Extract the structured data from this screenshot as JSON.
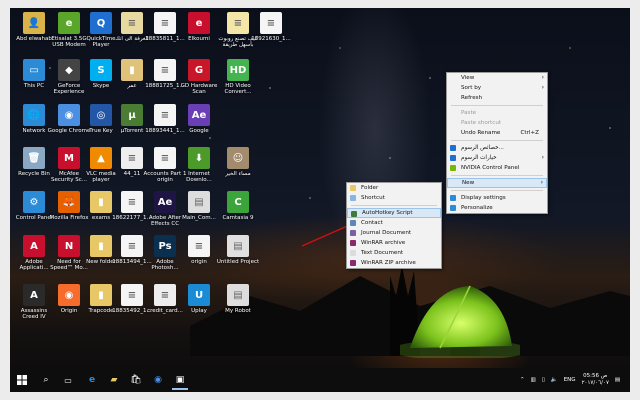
{
  "desktop": {
    "icons": [
      {
        "label": "Abd elwahab",
        "color": "#d9b34a",
        "glyph": "👤"
      },
      {
        "label": "Etisalat 3.5G USB Modem",
        "color": "#5aa62a",
        "glyph": "e"
      },
      {
        "label": "QuickTime Player",
        "color": "#1f6fd1",
        "glyph": "Q"
      },
      {
        "label": "الغرفة الى انك",
        "color": "#e8d9a0",
        "glyph": "≡"
      },
      {
        "label": "18835811_1...",
        "color": "#f5f5f5",
        "glyph": "≡"
      },
      {
        "label": "Elkoumi",
        "color": "#c8102e",
        "glyph": "e"
      },
      {
        "label": "كيف تصنع روبوت بأسهل طريقة",
        "color": "#f3e6a7",
        "glyph": "≡"
      },
      {
        "label": "18921630_1...",
        "color": "#f5f5f5",
        "glyph": "≡"
      },
      {
        "label": "This PC",
        "color": "#2b8bd6",
        "glyph": "▭"
      },
      {
        "label": "GeForce Experience",
        "color": "#444",
        "glyph": "◆"
      },
      {
        "label": "Skype",
        "color": "#00aff0",
        "glyph": "S"
      },
      {
        "label": "عمر",
        "color": "#e0c37a",
        "glyph": "▮"
      },
      {
        "label": "18881725_1...",
        "color": "#f5f5f5",
        "glyph": "≡"
      },
      {
        "label": "GD Hardware Scan",
        "color": "#c9172a",
        "glyph": "G"
      },
      {
        "label": "HD Video Convert...",
        "color": "#45b34f",
        "glyph": "HD"
      },
      {
        "label": "Network",
        "color": "#2b8bd6",
        "glyph": "🌐"
      },
      {
        "label": "Google Chrome",
        "color": "#4a8fe2",
        "glyph": "◉"
      },
      {
        "label": "True Key",
        "color": "#2456a8",
        "glyph": "◎"
      },
      {
        "label": "µTorrent",
        "color": "#4a7d33",
        "glyph": "µ"
      },
      {
        "label": "18893441_1...",
        "color": "#f5f5f5",
        "glyph": "≡"
      },
      {
        "label": "Google",
        "color": "#6a3fb5",
        "glyph": "Ae"
      },
      {
        "label": "Recycle Bin",
        "color": "#8aa7c4",
        "glyph": "🗑"
      },
      {
        "label": "McAfee Security Sc...",
        "color": "#c8102e",
        "glyph": "M"
      },
      {
        "label": "VLC media player",
        "color": "#f08a00",
        "glyph": "▲"
      },
      {
        "label": "44_11",
        "color": "#eee",
        "glyph": "≡"
      },
      {
        "label": "Accounts Part 1 origin",
        "color": "#f5f5f5",
        "glyph": "≡"
      },
      {
        "label": "Internet Downlo...",
        "color": "#4c9a2a",
        "glyph": "⬇"
      },
      {
        "label": "مساء الخير",
        "color": "#a38b6d",
        "glyph": "☺"
      },
      {
        "label": "Control Panel",
        "color": "#2b8bd6",
        "glyph": "⚙"
      },
      {
        "label": "Mozilla Firefox",
        "color": "#e66000",
        "glyph": "🦊"
      },
      {
        "label": "exams",
        "color": "#e8c766",
        "glyph": "▮"
      },
      {
        "label": "18622177_1...",
        "color": "#f5f5f5",
        "glyph": "≡"
      },
      {
        "label": "Adobe After Effects CC",
        "color": "#1e1545",
        "glyph": "Ae"
      },
      {
        "label": "Main_Com...",
        "color": "#ddd",
        "glyph": "▤"
      },
      {
        "label": "Camtasia 9",
        "color": "#3ba53b",
        "glyph": "C"
      },
      {
        "label": "Adobe Applicati...",
        "color": "#c8102e",
        "glyph": "A"
      },
      {
        "label": "Need for Speed™ Mo...",
        "color": "#c8102e",
        "glyph": "N"
      },
      {
        "label": "New folder",
        "color": "#e8c766",
        "glyph": "▮"
      },
      {
        "label": "18813494_1...",
        "color": "#f5f5f5",
        "glyph": "≡"
      },
      {
        "label": "Adobe Photosh...",
        "color": "#0b2f4e",
        "glyph": "Ps"
      },
      {
        "label": "origin",
        "color": "#f5f5f5",
        "glyph": "≡"
      },
      {
        "label": "Untitled Project",
        "color": "#e0e0e0",
        "glyph": "▤"
      },
      {
        "label": "Assassins Creed IV",
        "color": "#2a2a2a",
        "glyph": "A"
      },
      {
        "label": "Origin",
        "color": "#f56c2d",
        "glyph": "◉"
      },
      {
        "label": "Trapcode",
        "color": "#e8c766",
        "glyph": "▮"
      },
      {
        "label": "18835492_1...",
        "color": "#f5f5f5",
        "glyph": "≡"
      },
      {
        "label": "credit_card...",
        "color": "#eee",
        "glyph": "≡"
      },
      {
        "label": "Uplay",
        "color": "#1c8bd6",
        "glyph": "U"
      },
      {
        "label": "My Robot",
        "color": "#ddd",
        "glyph": "▤"
      }
    ]
  },
  "context_menu": {
    "items": [
      {
        "label": "View",
        "type": "sub"
      },
      {
        "label": "Sort by",
        "type": "sub"
      },
      {
        "label": "Refresh",
        "type": "normal"
      },
      {
        "type": "sep"
      },
      {
        "label": "Paste",
        "type": "disabled"
      },
      {
        "label": "Paste shortcut",
        "type": "disabled"
      },
      {
        "label": "Undo Rename",
        "type": "normal",
        "shortcut": "Ctrl+Z"
      },
      {
        "type": "sep"
      },
      {
        "label": "خصائص الرسوم...",
        "type": "normal",
        "icon": "#1e6fd1"
      },
      {
        "label": "خيارات الرسوم",
        "type": "sub",
        "icon": "#1e6fd1"
      },
      {
        "label": "NVIDIA Control Panel",
        "type": "normal",
        "icon": "#76b900"
      },
      {
        "type": "sep"
      },
      {
        "label": "New",
        "type": "sub-highlight"
      },
      {
        "type": "sep"
      },
      {
        "label": "Display settings",
        "type": "normal",
        "icon": "#2b8bd6"
      },
      {
        "label": "Personalize",
        "type": "normal",
        "icon": "#2b8bd6"
      }
    ]
  },
  "new_submenu": {
    "items": [
      {
        "label": "Folder",
        "icon": "#e8c766"
      },
      {
        "label": "Shortcut",
        "icon": "#8ab4e0"
      },
      {
        "type": "sep"
      },
      {
        "label": "AutoHotkey Script",
        "icon": "#3d7a3d",
        "highlight": true
      },
      {
        "label": "Contact",
        "icon": "#5f87b5"
      },
      {
        "label": "Journal Document",
        "icon": "#7a5fa5"
      },
      {
        "label": "WinRAR archive",
        "icon": "#8a2a6a"
      },
      {
        "label": "Text Document",
        "icon": "#dcdcdc"
      },
      {
        "label": "WinRAR ZIP archive",
        "icon": "#8a2a6a"
      }
    ]
  },
  "taskbar": {
    "clock_time": "05:56 ص",
    "clock_date": "٢٠١٧/٠٦/٠٧",
    "language": "ENG"
  }
}
